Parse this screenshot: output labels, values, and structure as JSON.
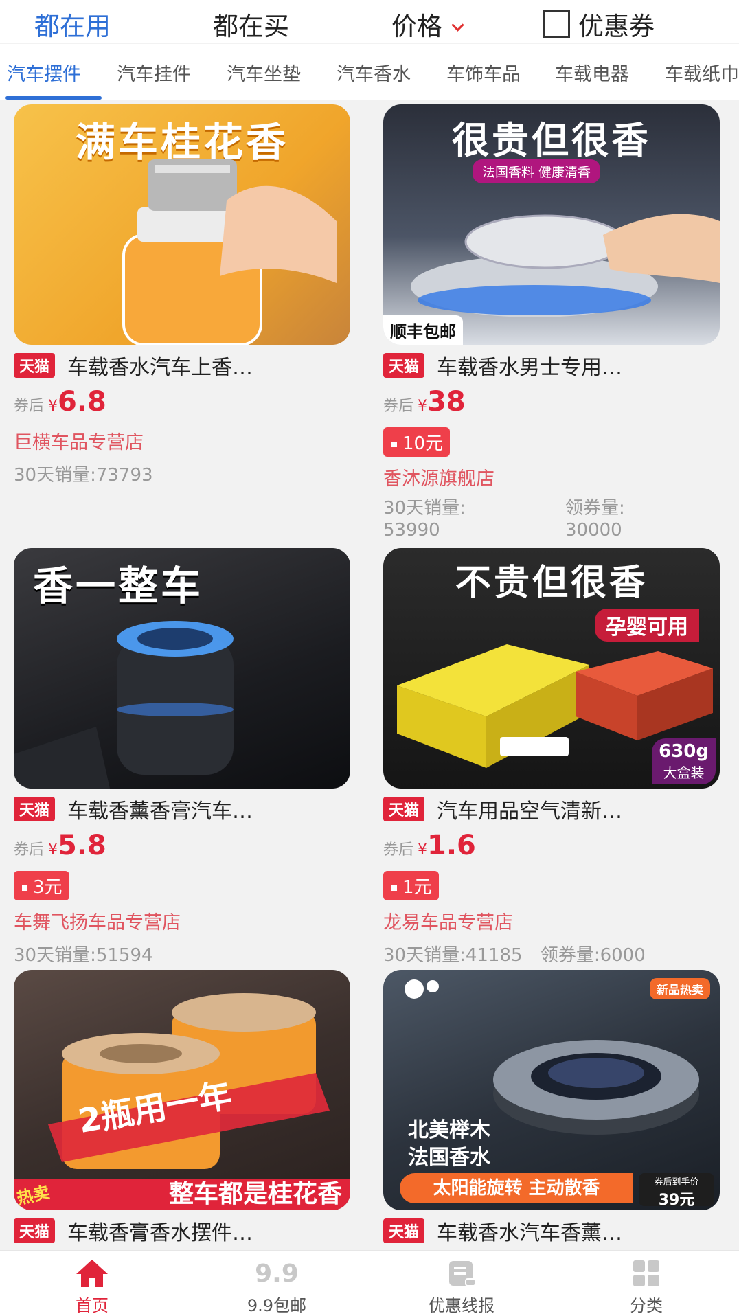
{
  "sortbar": {
    "items": [
      "都在用",
      "都在买",
      "价格",
      "优惠券"
    ]
  },
  "categories": [
    "汽车摆件",
    "汽车挂件",
    "汽车坐垫",
    "汽车香水",
    "车饰车品",
    "车载电器",
    "车载纸巾"
  ],
  "products": [
    {
      "headline": "满车桂花香",
      "badge": "天猫",
      "title": "车载香水汽车上香…",
      "price_prefix": "券后",
      "currency": "¥",
      "price": "6.8",
      "shop": "巨横车品专营店",
      "sales": "30天销量:73793"
    },
    {
      "headline": "很贵但很香",
      "sub_banner": "法国香料 健康清香",
      "corner_label": "顺丰包邮",
      "badge": "天猫",
      "title": "车载香水男士专用…",
      "price_prefix": "券后",
      "currency": "¥",
      "price": "38",
      "coupon": "10元",
      "shop": "香沐源旗舰店",
      "sales_label": "30天销量:",
      "sales_value": "53990",
      "coupon_count_label": "领券量:",
      "coupon_count_value": "30000"
    },
    {
      "headline": "香一整车",
      "badge": "天猫",
      "title": "车载香薰香膏汽车…",
      "price_prefix": "券后",
      "currency": "¥",
      "price": "5.8",
      "coupon": "3元",
      "shop": "车舞飞扬车品专营店",
      "sales": "30天销量:51594"
    },
    {
      "headline": "不贵但很香",
      "sub_banner": "孕婴可用",
      "weight_label": "630g",
      "box_label": "大盒装",
      "badge": "天猫",
      "title": "汽车用品空气清新…",
      "price_prefix": "券后",
      "currency": "¥",
      "price": "1.6",
      "coupon": "1元",
      "shop": "龙易车品专营店",
      "sales": "30天销量:41185",
      "coupon_count": "领券量:6000"
    },
    {
      "headline": "2瓶用一年",
      "bottom_banner": "整车都是桂花香",
      "corner_tag": "热卖",
      "badge": "天猫",
      "title": "车载香膏香水摆件…"
    },
    {
      "new_tag": "新品热卖",
      "line1": "北美榉木",
      "line2": "法国香水",
      "banner": "太阳能旋转 主动散香",
      "price_tag_label": "券后到手价",
      "price_tag_value": "39元",
      "badge": "天猫",
      "title": "车载香水汽车香薰…"
    }
  ],
  "bottomnav": {
    "items": [
      {
        "label": "首页",
        "icon": "home-icon"
      },
      {
        "label": "9.9包邮",
        "icon": "nine-nine-icon",
        "icon_text": "9.9"
      },
      {
        "label": "优惠线报",
        "icon": "news-icon"
      },
      {
        "label": "分类",
        "icon": "grid-icon"
      }
    ]
  },
  "colors": {
    "accent_blue": "#2e6fd6",
    "price_red": "#e0243a",
    "shop_pink": "#e05560"
  }
}
